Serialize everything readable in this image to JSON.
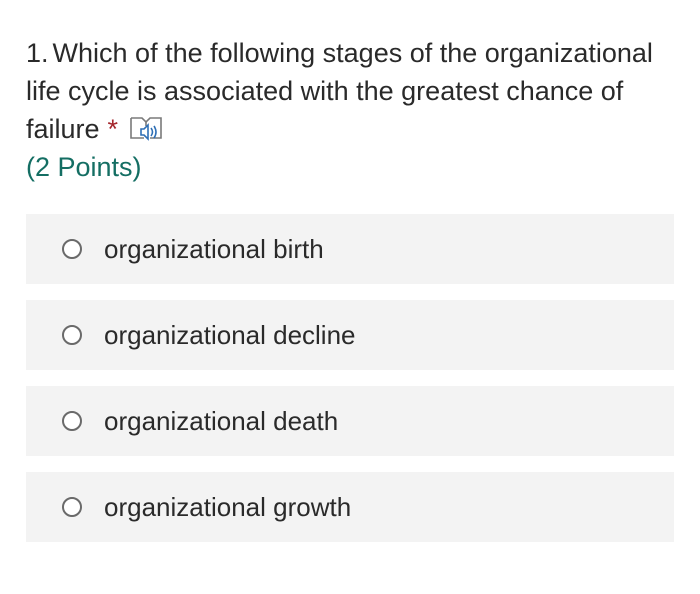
{
  "question": {
    "number": "1.",
    "text": "Which of the following stages of the organizational life cycle is associated with the greatest chance of failure",
    "required_mark": "*",
    "reader_icon": "immersive-reader-icon",
    "points": "(2 Points)"
  },
  "options": [
    {
      "label": "organizational birth"
    },
    {
      "label": "organizational decline"
    },
    {
      "label": "organizational death"
    },
    {
      "label": "organizational growth"
    }
  ],
  "colors": {
    "points": "#146e63",
    "required": "#a4262c",
    "option_bg": "#f3f3f3"
  }
}
